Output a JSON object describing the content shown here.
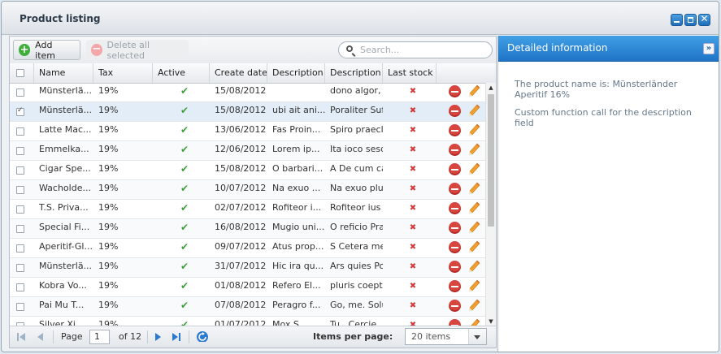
{
  "window": {
    "title": "Product listing"
  },
  "toolbar": {
    "add_label": "Add item",
    "delete_label": "Delete all selected",
    "search_placeholder": "Search..."
  },
  "columns": [
    "Name",
    "Tax",
    "Active",
    "Create date",
    "Description",
    "Description lo",
    "Last stock"
  ],
  "rows": [
    {
      "name": "Münsterlä...",
      "tax": "19%",
      "date": "15/08/2012",
      "desc": "",
      "desc_long": "dono algor, ir",
      "selected": false
    },
    {
      "name": "Münsterlä...",
      "tax": "19%",
      "date": "15/08/2012",
      "desc": "ubi ait ani...",
      "desc_long": "Poraliter Suffi",
      "selected": true
    },
    {
      "name": "Latte Mac...",
      "tax": "19%",
      "date": "13/06/2012",
      "desc": "Fas Proin...",
      "desc_long": "Spiro praecla",
      "selected": false
    },
    {
      "name": "Emmelka...",
      "tax": "19%",
      "date": "12/06/2012",
      "desc": "Lorem ip...",
      "desc_long": "Ita ioco sesqu",
      "selected": false
    },
    {
      "name": "Cigar Spe...",
      "tax": "19%",
      "date": "15/08/2012",
      "desc": "O barbari...",
      "desc_long": "A De cum cas",
      "selected": false
    },
    {
      "name": "Wacholde...",
      "tax": "19%",
      "date": "10/07/2012",
      "desc": "Na exuo ...",
      "desc_long": "Na exuo plura",
      "selected": false
    },
    {
      "name": "T.S. Priva...",
      "tax": "19%",
      "date": "02/07/2012",
      "desc": "Rofiteor i...",
      "desc_long": "Rofiteor ius P",
      "selected": false
    },
    {
      "name": "Special Fi...",
      "tax": "19%",
      "date": "16/08/2012",
      "desc": "Mugio uni...",
      "desc_long": "O reficio Prae",
      "selected": false
    },
    {
      "name": "Aperitif-Gl...",
      "tax": "19%",
      "date": "09/07/2012",
      "desc": "Atus prop...",
      "desc_long": "S Cetera mel",
      "selected": false
    },
    {
      "name": "Münsterlä...",
      "tax": "19%",
      "date": "31/07/2012",
      "desc": "Hic ira qu...",
      "desc_long": "Ars quies Pol",
      "selected": false
    },
    {
      "name": "Kobra Vo...",
      "tax": "19%",
      "date": "01/08/2012",
      "desc": "Refero El...",
      "desc_long": "pluris coepto,",
      "selected": false
    },
    {
      "name": "Pai Mu T...",
      "tax": "19%",
      "date": "07/08/2012",
      "desc": "Peragro f...",
      "desc_long": "Go, me. Solu",
      "selected": false
    },
    {
      "name": "Silver Xi...",
      "tax": "19%",
      "date": "01/07/2012",
      "desc": "Mox S...",
      "desc_long": "Tu . Cercie",
      "selected": false
    }
  ],
  "pager": {
    "page_label": "Page",
    "page_value": "1",
    "of_label": "of 12",
    "items_per_page_label": "Items per page:",
    "items_per_page_value": "20 items"
  },
  "detail": {
    "title": "Detailed information",
    "line1": "The product name is: Münsterländer Aperitif 16%",
    "line2": "Custom function call for the description field"
  },
  "colors": {
    "accent": "#2b86d6",
    "active_check": "#3f9f3a",
    "stock_x": "#d23a3a"
  }
}
